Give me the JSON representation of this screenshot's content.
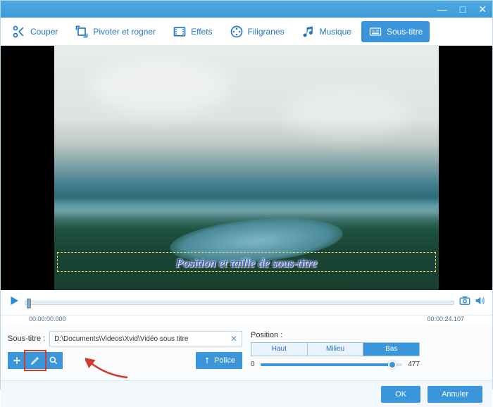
{
  "window": {
    "minimize": "—",
    "maximize": "□",
    "close": "✕"
  },
  "tabs": {
    "cut": "Couper",
    "rotate": "Pivoter et rogner",
    "effects": "Effets",
    "watermark": "Filigranes",
    "music": "Musique",
    "subtitle": "Sous-titre"
  },
  "preview": {
    "subtitle_text": "Position et taille de sous-titre"
  },
  "timeline": {
    "current": "00:00:00.000",
    "total": "00:00:24.107"
  },
  "subtitle": {
    "label": "Sous-titre :",
    "path": "D:\\Documents\\Videos\\Xvid\\Vidéo sous titre",
    "police": "Police"
  },
  "position": {
    "label": "Position :",
    "top": "Haut",
    "middle": "Milieu",
    "bottom": "Bas",
    "min": "0",
    "max": "477",
    "value_pct": 93
  },
  "footer": {
    "ok": "OK",
    "cancel": "Annuler"
  }
}
